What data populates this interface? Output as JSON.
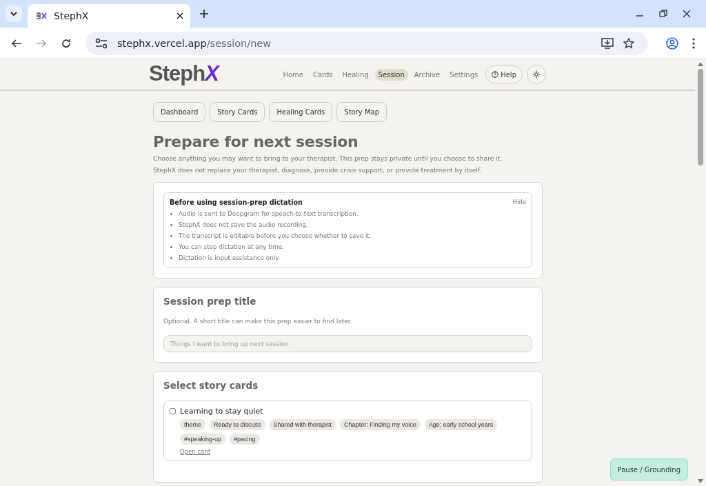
{
  "browser": {
    "tab_title": "StephX",
    "url_host": "stephx.vercel.app",
    "url_path": "/session/new"
  },
  "header": {
    "logo": "Steph",
    "logo_accent": "X",
    "nav": [
      {
        "label": "Home",
        "selected": false
      },
      {
        "label": "Cards",
        "selected": false
      },
      {
        "label": "Healing",
        "selected": false
      },
      {
        "label": "Session",
        "selected": true
      },
      {
        "label": "Archive",
        "selected": false
      },
      {
        "label": "Settings",
        "selected": false
      }
    ],
    "help": "Help"
  },
  "subnav": [
    "Dashboard",
    "Story Cards",
    "Healing Cards",
    "Story Map"
  ],
  "title": "Prepare for next session",
  "intro": [
    "Choose anything you may want to bring to your therapist. This prep stays private until you choose to share it.",
    "StephX does not replace your therapist, diagnose, provide crisis support, or provide treatment by itself."
  ],
  "dictation_notice": {
    "title": "Before using session-prep dictation",
    "hide": "Hide",
    "items": [
      "Audio is sent to Deepgram for speech-to-text transcription.",
      "StephX does not save the audio recording.",
      "The transcript is editable before you choose whether to save it.",
      "You can stop dictation at any time.",
      "Dictation is input assistance only."
    ]
  },
  "prep_title": {
    "heading": "Session prep title",
    "hint": "Optional. A short title can make this prep easier to find later.",
    "placeholder": "Things I want to bring up next session"
  },
  "story_cards": {
    "heading": "Select story cards",
    "cards": [
      {
        "title": "Learning to stay quiet",
        "checked": false,
        "tags": [
          "theme",
          "Ready to discuss",
          "Shared with therapist",
          "Chapter: Finding my voice",
          "Age: early school years",
          "#speaking-up",
          "#pacing"
        ],
        "link": "Open card"
      }
    ]
  },
  "pause_button": "Pause / Grounding"
}
